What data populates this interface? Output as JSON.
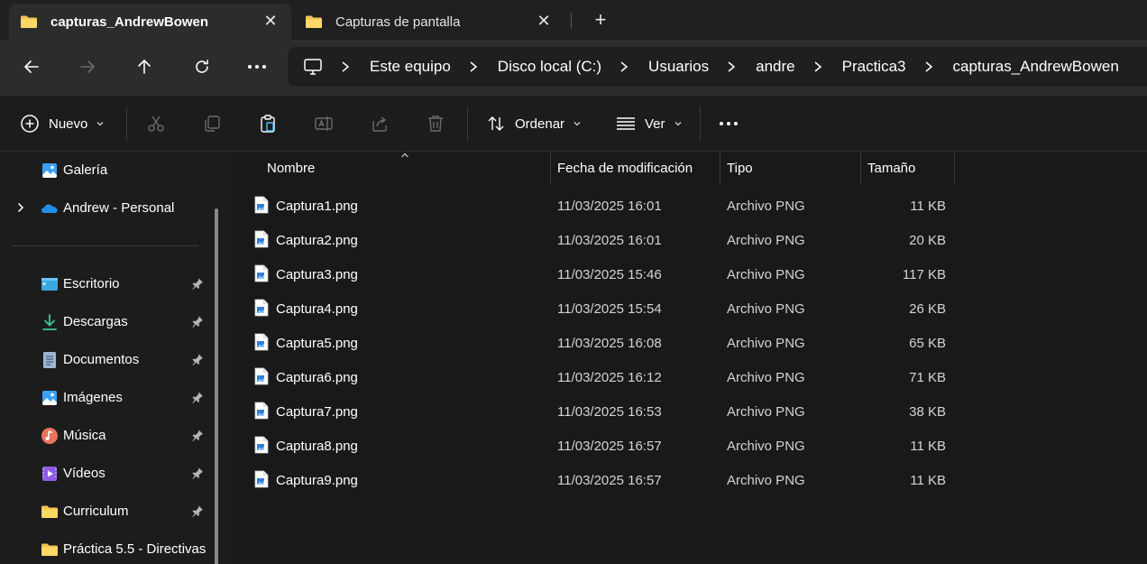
{
  "tabs": [
    {
      "label": "capturas_AndrewBowen",
      "active": true
    },
    {
      "label": "Capturas de pantalla",
      "active": false
    }
  ],
  "new_tab_symbol": "+",
  "close_symbol": "✕",
  "nav": {
    "back_icon": "arrow-left-icon",
    "forward_icon": "arrow-right-icon",
    "up_icon": "arrow-up-icon",
    "refresh_icon": "refresh-icon",
    "more_icon": "ellipsis-icon"
  },
  "breadcrumb": [
    "Este equipo",
    "Disco local (C:)",
    "Usuarios",
    "andre",
    "Practica3",
    "capturas_AndrewBowen"
  ],
  "toolbar": {
    "new_label": "Nuevo",
    "sort_label": "Ordenar",
    "view_label": "Ver",
    "more_symbol": "•••"
  },
  "sidebar": {
    "items": [
      {
        "label": "Galería",
        "icon": "gallery-icon",
        "pinned": false
      },
      {
        "label": "Andrew - Personal",
        "icon": "onedrive-cloud-icon",
        "pinned": false,
        "expandable": true
      },
      {
        "label": "Escritorio",
        "icon": "desktop-icon",
        "pinned": true
      },
      {
        "label": "Descargas",
        "icon": "download-icon",
        "pinned": true
      },
      {
        "label": "Documentos",
        "icon": "documents-icon",
        "pinned": true
      },
      {
        "label": "Imágenes",
        "icon": "pictures-icon",
        "pinned": true
      },
      {
        "label": "Música",
        "icon": "music-icon",
        "pinned": true
      },
      {
        "label": "Vídeos",
        "icon": "videos-icon",
        "pinned": true
      },
      {
        "label": "Curriculum",
        "icon": "folder-icon",
        "pinned": true
      },
      {
        "label": "Práctica 5.5 - Directivas",
        "icon": "folder-icon",
        "pinned": false
      }
    ]
  },
  "columns": {
    "name": "Nombre",
    "date": "Fecha de modificación",
    "type": "Tipo",
    "size": "Tamaño"
  },
  "files": [
    {
      "name": "Captura1.png",
      "date": "11/03/2025 16:01",
      "type": "Archivo PNG",
      "size": "11 KB"
    },
    {
      "name": "Captura2.png",
      "date": "11/03/2025 16:01",
      "type": "Archivo PNG",
      "size": "20 KB"
    },
    {
      "name": "Captura3.png",
      "date": "11/03/2025 15:46",
      "type": "Archivo PNG",
      "size": "117 KB"
    },
    {
      "name": "Captura4.png",
      "date": "11/03/2025 15:54",
      "type": "Archivo PNG",
      "size": "26 KB"
    },
    {
      "name": "Captura5.png",
      "date": "11/03/2025 16:08",
      "type": "Archivo PNG",
      "size": "65 KB"
    },
    {
      "name": "Captura6.png",
      "date": "11/03/2025 16:12",
      "type": "Archivo PNG",
      "size": "71 KB"
    },
    {
      "name": "Captura7.png",
      "date": "11/03/2025 16:53",
      "type": "Archivo PNG",
      "size": "38 KB"
    },
    {
      "name": "Captura8.png",
      "date": "11/03/2025 16:57",
      "type": "Archivo PNG",
      "size": "11 KB"
    },
    {
      "name": "Captura9.png",
      "date": "11/03/2025 16:57",
      "type": "Archivo PNG",
      "size": "11 KB"
    }
  ],
  "colors": {
    "folder": "#f5c64f",
    "accent": "#4cc2ff",
    "background": "#191919"
  }
}
